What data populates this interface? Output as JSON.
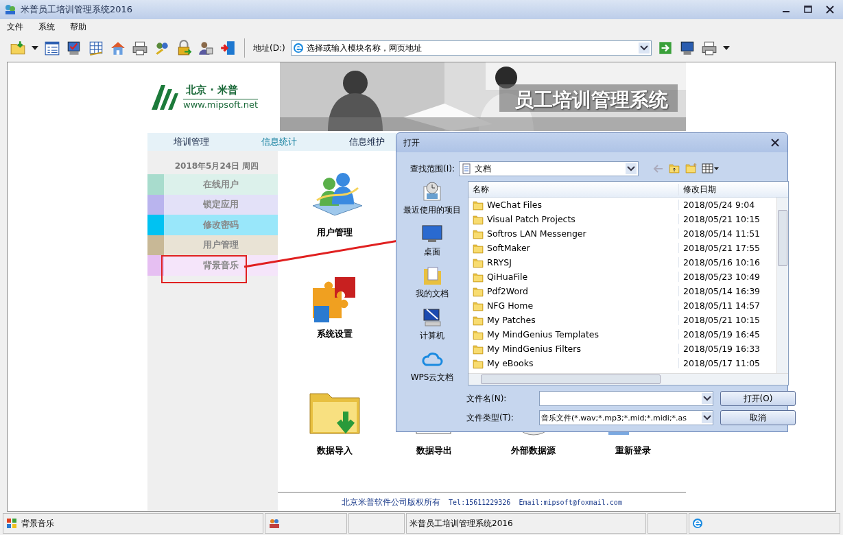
{
  "window": {
    "title": "米普员工培训管理系统2016"
  },
  "menu": [
    "文件",
    "系统",
    "帮助"
  ],
  "address_bar": {
    "label": "地址(D:)",
    "value": "选择或输入模块名称，网页地址"
  },
  "logo": {
    "name": "北京 · 米普",
    "url": "www.mipsoft.net"
  },
  "banner": {
    "title": "员工培训管理系统"
  },
  "nav": [
    {
      "label": "培训管理",
      "selected": false
    },
    {
      "label": "信息统计",
      "selected": true
    },
    {
      "label": "信息维护",
      "selected": false
    }
  ],
  "sidebar": {
    "date": "2018年5月24日  周四",
    "items": [
      {
        "label": "在线用户",
        "color": "#a8dccd"
      },
      {
        "label": "锁定应用",
        "color": "#b9b4ee"
      },
      {
        "label": "修改密码",
        "color": "#00c2f2"
      },
      {
        "label": "用户管理",
        "color": "#c8b896"
      },
      {
        "label": "背景音乐",
        "color": "#e6bff2"
      }
    ]
  },
  "tiles": [
    [
      {
        "label": "用户管理"
      }
    ],
    [
      {
        "label": "系统设置"
      }
    ],
    [
      {
        "label": "数据导入"
      },
      {
        "label": "数据导出"
      },
      {
        "label": "外部数据源"
      },
      {
        "label": "重新登录"
      }
    ]
  ],
  "footer": {
    "company": "北京米普软件公司版权所有",
    "tel": "Tel:15611229326",
    "email": "Email:mipsoft@foxmail.com"
  },
  "dialog": {
    "title": "打开",
    "look_in_label": "查找范围(I):",
    "look_in_value": "文档",
    "places": [
      "最近使用的项目",
      "桌面",
      "我的文档",
      "计算机",
      "WPS云文档"
    ],
    "columns": [
      "名称",
      "修改日期"
    ],
    "files": [
      {
        "name": "WeChat Files",
        "modified": "2018/05/24 9:04"
      },
      {
        "name": "Visual Patch Projects",
        "modified": "2018/05/21 10:15"
      },
      {
        "name": "Softros LAN Messenger",
        "modified": "2018/05/14 11:51"
      },
      {
        "name": "SoftMaker",
        "modified": "2018/05/21 17:55"
      },
      {
        "name": "RRYSJ",
        "modified": "2018/05/16 10:16"
      },
      {
        "name": "QiHuaFile",
        "modified": "2018/05/23 10:49"
      },
      {
        "name": "Pdf2Word",
        "modified": "2018/05/14 16:39"
      },
      {
        "name": "NFG Home",
        "modified": "2018/05/11 14:57"
      },
      {
        "name": "My Patches",
        "modified": "2018/05/21 10:15"
      },
      {
        "name": "My MindGenius Templates",
        "modified": "2018/05/19 16:45"
      },
      {
        "name": "My MindGenius Filters",
        "modified": "2018/05/19 16:33"
      },
      {
        "name": "My eBooks",
        "modified": "2018/05/17 11:05"
      }
    ],
    "filename_label": "文件名(N):",
    "filetype_label": "文件类型(T):",
    "filetype_value": "音乐文件(*.wav;*.mp3;*.mid;*.midi;*.as",
    "buttons": [
      "打开(O)",
      "取消"
    ]
  },
  "status_bar": {
    "message": "背景音乐",
    "app": "米普员工培训管理系统2016"
  }
}
